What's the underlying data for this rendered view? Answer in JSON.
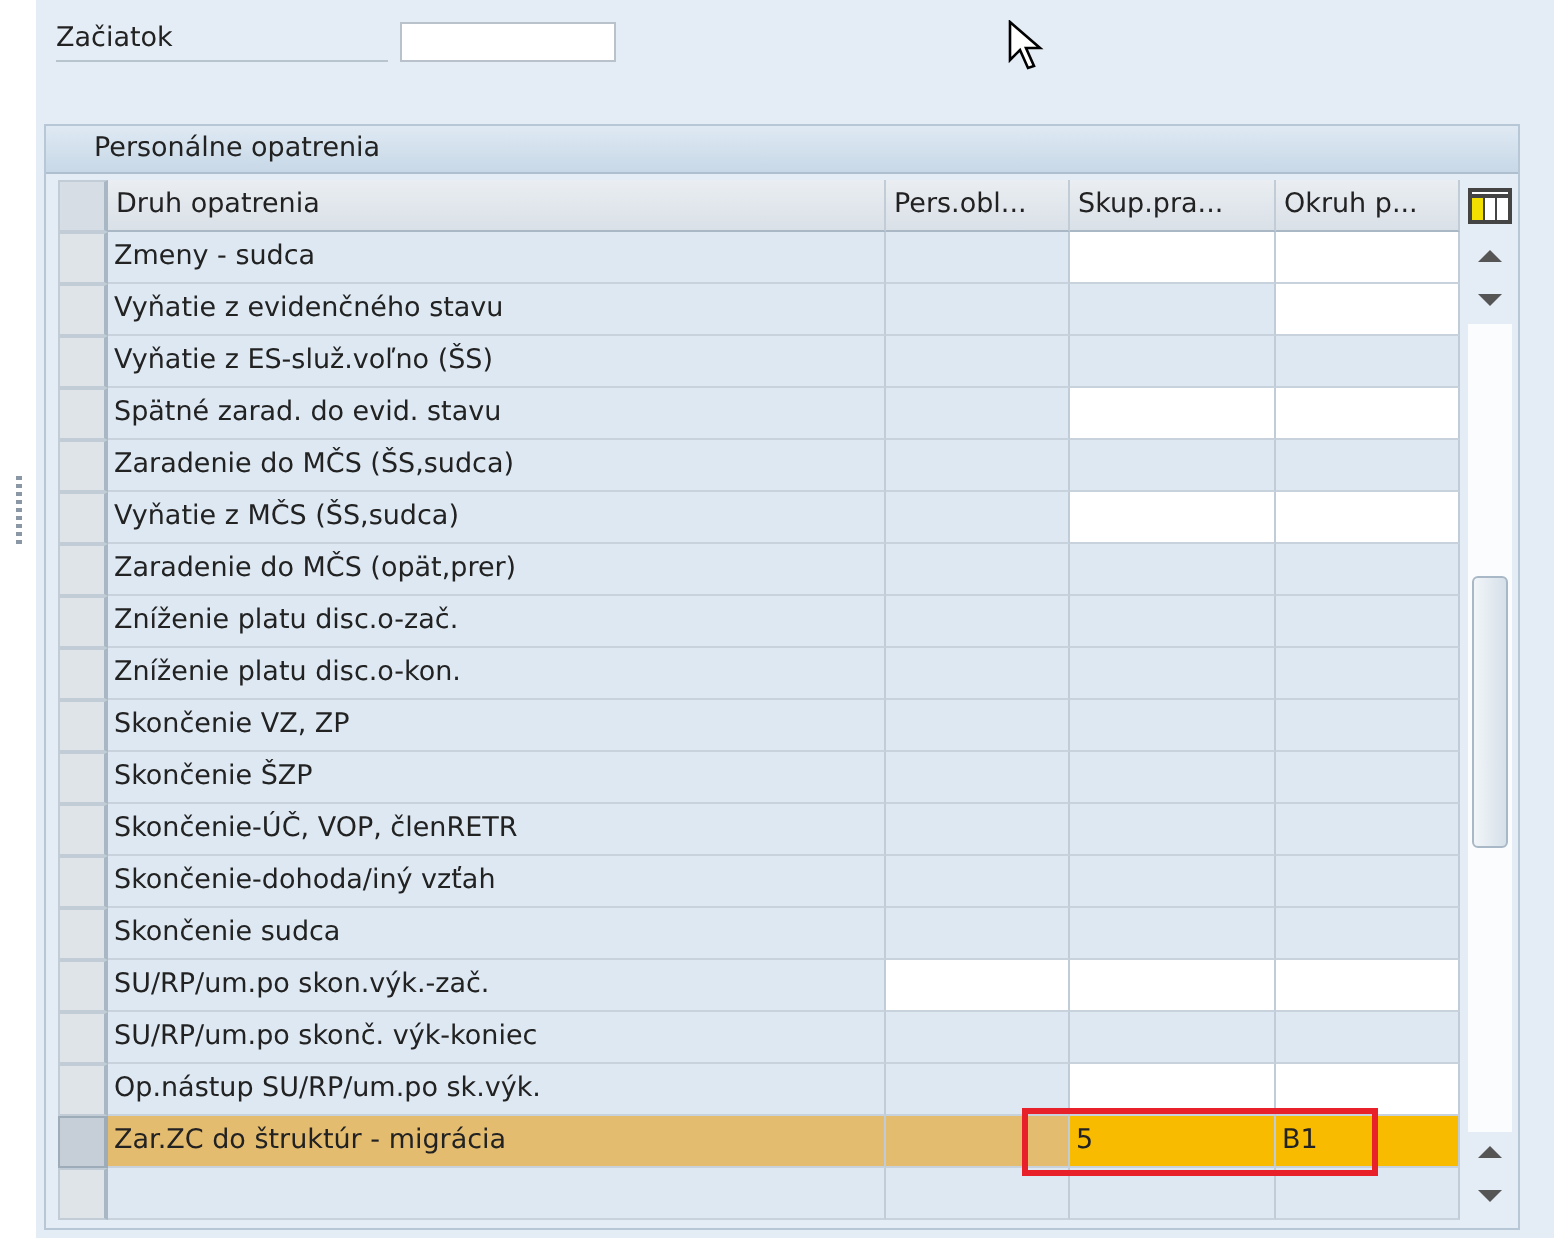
{
  "form": {
    "label": "Začiatok"
  },
  "table": {
    "title": "Personálne opatrenia",
    "columns": [
      "Druh opatrenia",
      "Pers.obl...",
      "Skup.pra...",
      "Okruh p..."
    ],
    "rows": [
      {
        "selected": false,
        "cells": [
          {
            "value": "Zmeny - sudca"
          },
          {
            "editable": false
          },
          {
            "editable": true
          },
          {
            "editable": true
          }
        ]
      },
      {
        "selected": false,
        "cells": [
          {
            "value": "Vyňatie z evidenčného stavu"
          },
          {
            "editable": false
          },
          {
            "editable": false
          },
          {
            "editable": true
          }
        ]
      },
      {
        "selected": false,
        "cells": [
          {
            "value": "Vyňatie z ES-služ.voľno (ŠS)"
          },
          {
            "editable": false
          },
          {
            "editable": false
          },
          {
            "editable": false
          }
        ]
      },
      {
        "selected": false,
        "cells": [
          {
            "value": "Spätné zarad. do evid. stavu"
          },
          {
            "editable": false
          },
          {
            "editable": true
          },
          {
            "editable": true
          }
        ]
      },
      {
        "selected": false,
        "cells": [
          {
            "value": "Zaradenie do MČS (ŠS,sudca)"
          },
          {
            "editable": false
          },
          {
            "editable": false
          },
          {
            "editable": false
          }
        ]
      },
      {
        "selected": false,
        "cells": [
          {
            "value": "Vyňatie z MČS (ŠS,sudca)"
          },
          {
            "editable": false
          },
          {
            "editable": true
          },
          {
            "editable": true
          }
        ]
      },
      {
        "selected": false,
        "cells": [
          {
            "value": "Zaradenie do MČS (opät,prer)"
          },
          {
            "editable": false
          },
          {
            "editable": false
          },
          {
            "editable": false
          }
        ]
      },
      {
        "selected": false,
        "cells": [
          {
            "value": "Zníženie platu disc.o-zač."
          },
          {
            "editable": false
          },
          {
            "editable": false
          },
          {
            "editable": false
          }
        ]
      },
      {
        "selected": false,
        "cells": [
          {
            "value": "Zníženie platu disc.o-kon."
          },
          {
            "editable": false
          },
          {
            "editable": false
          },
          {
            "editable": false
          }
        ]
      },
      {
        "selected": false,
        "cells": [
          {
            "value": "Skončenie VZ, ZP"
          },
          {
            "editable": false
          },
          {
            "editable": false
          },
          {
            "editable": false
          }
        ]
      },
      {
        "selected": false,
        "cells": [
          {
            "value": "Skončenie ŠZP"
          },
          {
            "editable": false
          },
          {
            "editable": false
          },
          {
            "editable": false
          }
        ]
      },
      {
        "selected": false,
        "cells": [
          {
            "value": "Skončenie-ÚČ, VOP, členRETR"
          },
          {
            "editable": false
          },
          {
            "editable": false
          },
          {
            "editable": false
          }
        ]
      },
      {
        "selected": false,
        "cells": [
          {
            "value": "Skončenie-dohoda/iný vzťah"
          },
          {
            "editable": false
          },
          {
            "editable": false
          },
          {
            "editable": false
          }
        ]
      },
      {
        "selected": false,
        "cells": [
          {
            "value": "Skončenie sudca"
          },
          {
            "editable": false
          },
          {
            "editable": false
          },
          {
            "editable": false
          }
        ]
      },
      {
        "selected": false,
        "cells": [
          {
            "value": "SU/RP/um.po skon.výk.-zač."
          },
          {
            "editable": true
          },
          {
            "editable": true
          },
          {
            "editable": true
          }
        ]
      },
      {
        "selected": false,
        "cells": [
          {
            "value": "SU/RP/um.po skonč. výk-koniec"
          },
          {
            "editable": false
          },
          {
            "editable": false
          },
          {
            "editable": false
          }
        ]
      },
      {
        "selected": false,
        "cells": [
          {
            "value": "Op.nástup SU/RP/um.po sk.výk."
          },
          {
            "editable": false
          },
          {
            "editable": true
          },
          {
            "editable": true
          }
        ]
      },
      {
        "selected": true,
        "highlighted": true,
        "cells": [
          {
            "value": "Zar.ZC do štruktúr - migrácia"
          },
          {
            "editable": false
          },
          {
            "value": "5",
            "editable": true
          },
          {
            "value": "B1",
            "editable": true
          }
        ]
      },
      {
        "selected": false,
        "cells": [
          {},
          {
            "editable": false
          },
          {
            "editable": false
          },
          {
            "editable": false
          }
        ]
      }
    ]
  }
}
